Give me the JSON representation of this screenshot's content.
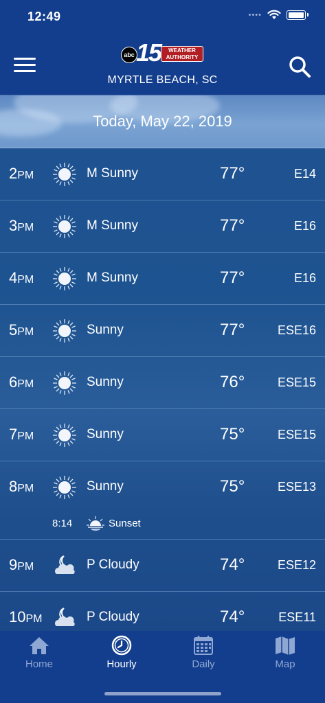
{
  "status": {
    "time": "12:49",
    "signal": "••••"
  },
  "header": {
    "logo_abc": "abc",
    "logo_number": "15",
    "logo_tag_line1": "WEATHER",
    "logo_tag_line2": "AUTHORITY",
    "location": "MYRTLE BEACH, SC"
  },
  "date": "Today, May 22, 2019",
  "hours": [
    {
      "hour": "2",
      "ampm": "PM",
      "icon": "sun-icon",
      "condition": "M Sunny",
      "temp": "77°",
      "wind": "E14"
    },
    {
      "hour": "3",
      "ampm": "PM",
      "icon": "sun-icon",
      "condition": "M Sunny",
      "temp": "77°",
      "wind": "E16"
    },
    {
      "hour": "4",
      "ampm": "PM",
      "icon": "sun-icon",
      "condition": "M Sunny",
      "temp": "77°",
      "wind": "E16"
    },
    {
      "hour": "5",
      "ampm": "PM",
      "icon": "sun-icon",
      "condition": "Sunny",
      "temp": "77°",
      "wind": "ESE16"
    },
    {
      "hour": "6",
      "ampm": "PM",
      "icon": "sun-icon",
      "condition": "Sunny",
      "temp": "76°",
      "wind": "ESE15"
    },
    {
      "hour": "7",
      "ampm": "PM",
      "icon": "sun-icon",
      "condition": "Sunny",
      "temp": "75°",
      "wind": "ESE15"
    },
    {
      "hour": "8",
      "ampm": "PM",
      "icon": "sun-icon",
      "condition": "Sunny",
      "temp": "75°",
      "wind": "ESE13",
      "event_time": "8:14",
      "event_label": "Sunset"
    },
    {
      "hour": "9",
      "ampm": "PM",
      "icon": "moon-cloud-icon",
      "condition": "P Cloudy",
      "temp": "74°",
      "wind": "ESE12"
    },
    {
      "hour": "10",
      "ampm": "PM",
      "icon": "moon-cloud-icon",
      "condition": "P Cloudy",
      "temp": "74°",
      "wind": "ESE11"
    }
  ],
  "tabs": [
    {
      "label": "Home",
      "icon": "home-icon",
      "active": false
    },
    {
      "label": "Hourly",
      "icon": "clock-icon",
      "active": true
    },
    {
      "label": "Daily",
      "icon": "calendar-icon",
      "active": false
    },
    {
      "label": "Map",
      "icon": "map-icon",
      "active": false
    }
  ],
  "colors": {
    "header": "#133e8e",
    "tag_red": "#b11e24",
    "inactive_tab": "#8fa7d3"
  }
}
